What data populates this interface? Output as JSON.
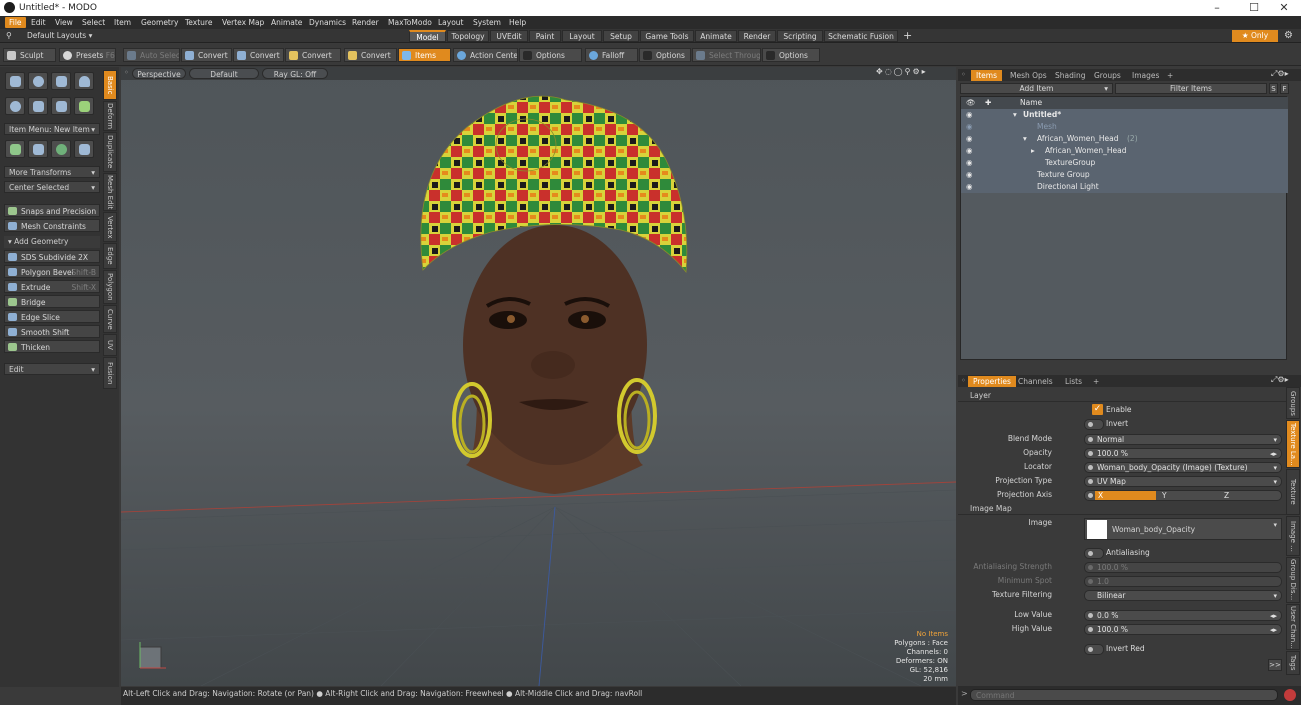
{
  "window": {
    "title": "Untitled* - MODO",
    "minimize": "–",
    "maximize": "☐",
    "close": "✕"
  },
  "menu": [
    "File",
    "Edit",
    "View",
    "Select",
    "Item",
    "Geometry",
    "Texture",
    "Vertex Map",
    "Animate",
    "Dynamics",
    "Render",
    "MaxToModo",
    "Layout",
    "System",
    "Help"
  ],
  "layouts": {
    "default": "Default Layouts ▾",
    "tabs": [
      "Model",
      "Topology",
      "UVEdit",
      "Paint",
      "Layout",
      "Setup",
      "Game Tools",
      "Animate",
      "Render",
      "Scripting",
      "Schematic Fusion"
    ],
    "add": "+",
    "only": "★  Only",
    "gear": "⚙"
  },
  "toolbar": {
    "sculpt": "Sculpt",
    "presets": "Presets",
    "presets_key": "F6",
    "buttons": [
      "Auto Select",
      "Convert",
      "Convert",
      "Convert",
      "Convert",
      "Items",
      "Action Center",
      "Options",
      "Falloff",
      "Options",
      "Select Through",
      "Options"
    ]
  },
  "left": {
    "item_menu": "Item Menu: New Item",
    "more_transforms": "More Transforms",
    "center_selected": "Center Selected",
    "snaps": "Snaps and Precision",
    "mesh_constraints": "Mesh Constraints",
    "add_geometry": "Add Geometry",
    "tools": [
      {
        "label": "SDS Subdivide 2X",
        "shortcut": ""
      },
      {
        "label": "Polygon Bevel",
        "shortcut": "Shift-B"
      },
      {
        "label": "Extrude",
        "shortcut": "Shift-X"
      },
      {
        "label": "Bridge",
        "shortcut": ""
      },
      {
        "label": "Edge Slice",
        "shortcut": ""
      },
      {
        "label": "Smooth Shift",
        "shortcut": ""
      },
      {
        "label": "Thicken",
        "shortcut": ""
      }
    ],
    "edit": "Edit",
    "vtabs": [
      "Basic",
      "Deform",
      "Duplicate",
      "Mesh Edit",
      "Vertex",
      "Edge",
      "Polygon",
      "Curve",
      "UV",
      "Fusion"
    ]
  },
  "viewport": {
    "view": "Perspective",
    "shading": "Default",
    "raygl": "Ray GL: Off",
    "stats": {
      "selection": "No Items",
      "polygons": "Polygons : Face",
      "channels": "Channels: 0",
      "deformers": "Deformers: ON",
      "gl": "GL: 52,816",
      "size": "20 mm"
    }
  },
  "status": "Alt-Left Click and Drag: Navigation: Rotate (or Pan) ● Alt-Right Click and Drag: Navigation: Freewheel ● Alt-Middle Click and Drag: navRoll",
  "items_panel": {
    "tabs": [
      "Items",
      "Mesh Ops",
      "Shading",
      "Groups",
      "Images"
    ],
    "add_item": "Add Item",
    "filter": "Filter Items",
    "s": "S",
    "f": "F",
    "column": "Name",
    "rows": [
      {
        "name": "Untitled*",
        "indent": 0,
        "expander": "▾"
      },
      {
        "name": "Mesh",
        "indent": 1,
        "expander": ""
      },
      {
        "name": "African_Women_Head",
        "suffix": "(2)",
        "indent": 1,
        "expander": "▾"
      },
      {
        "name": "African_Women_Head",
        "indent": 2,
        "expander": "▸"
      },
      {
        "name": "TextureGroup",
        "indent": 2,
        "expander": ""
      },
      {
        "name": "Texture Group",
        "indent": 1,
        "expander": ""
      },
      {
        "name": "Directional Light",
        "indent": 1,
        "expander": ""
      }
    ]
  },
  "properties_panel": {
    "tabs": [
      "Properties",
      "Channels",
      "Lists"
    ],
    "layer": "Layer",
    "enable": "Enable",
    "invert": "Invert",
    "blend_mode": {
      "label": "Blend Mode",
      "value": "Normal"
    },
    "opacity": {
      "label": "Opacity",
      "value": "100.0 %"
    },
    "locator": {
      "label": "Locator",
      "value": "Woman_body_Opacity (Image) (Texture)"
    },
    "projection_type": {
      "label": "Projection Type",
      "value": "UV Map"
    },
    "projection_axis": {
      "label": "Projection Axis",
      "x": "X",
      "y": "Y",
      "z": "Z"
    },
    "image_map": "Image Map",
    "image": {
      "label": "Image",
      "value": "Woman_body_Opacity"
    },
    "antialiasing": "Antialiasing",
    "aa_strength": {
      "label": "Antialiasing Strength",
      "value": "100.0 %"
    },
    "minimum_spot": {
      "label": "Minimum Spot",
      "value": "1.0"
    },
    "texture_filtering": {
      "label": "Texture Filtering",
      "value": "Bilinear"
    },
    "low_value": {
      "label": "Low Value",
      "value": "0.0 %"
    },
    "high_value": {
      "label": "High Value",
      "value": "100.0 %"
    },
    "invert_red": "Invert Red",
    "more": ">>",
    "vtabs": [
      "Groups",
      "Texture La...",
      "Texture Loc...",
      "Image ...",
      "Group Dis...",
      "User Chan...",
      "Tags"
    ]
  },
  "command": {
    "placeholder": "Command"
  }
}
